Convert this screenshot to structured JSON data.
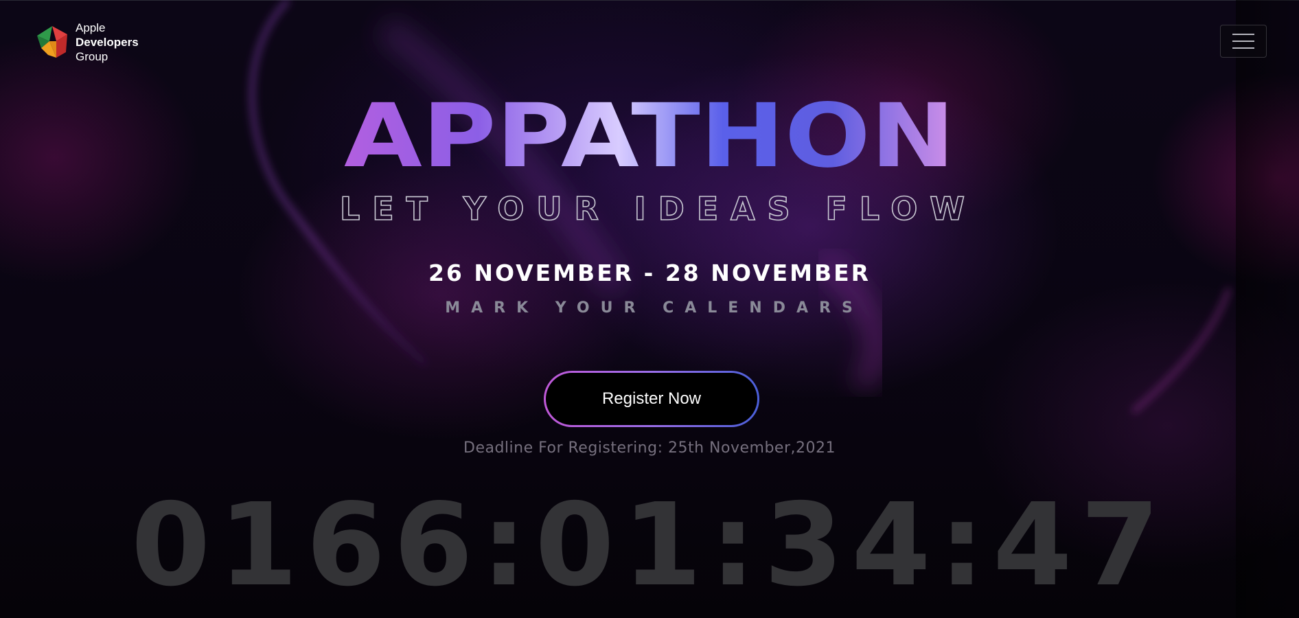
{
  "header": {
    "logo": {
      "icon": "apple-developers-group-logo",
      "line1": "Apple",
      "line2": "Developers",
      "line3": "Group"
    },
    "menu_icon": "hamburger-menu-icon"
  },
  "hero": {
    "title": "APPATHON",
    "tagline": "LET YOUR IDEAS FLOW",
    "dates": "26 NOVEMBER - 28 NOVEMBER",
    "subtitle": "MARK YOUR CALENDARS",
    "register_label": "Register Now",
    "deadline": "Deadline For Registering: 25th November,2021",
    "countdown": "0166:01:34:47"
  },
  "colors": {
    "background": "#07040c",
    "title_gradient": [
      "#b25fe0",
      "#7b55e8",
      "#d6c8ff",
      "#4f5de8",
      "#c88ae8"
    ],
    "button_border": [
      "#c058d8",
      "#4a5fd8"
    ],
    "countdown": "#333336"
  }
}
